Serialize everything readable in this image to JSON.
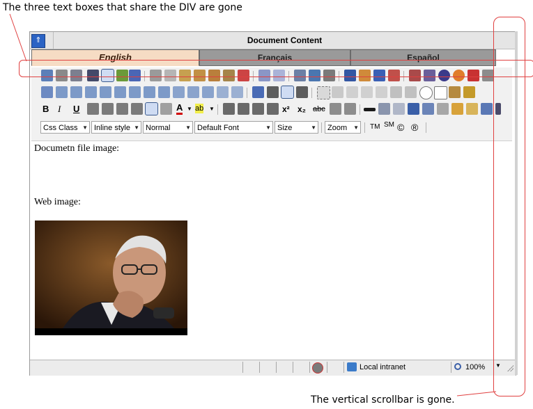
{
  "annotations": {
    "top_note": "The three text boxes that share the DIV are gone",
    "bottom_note": "The vertical scrollbar is gone."
  },
  "editor": {
    "title": "Document Content",
    "tabs": [
      {
        "label": "English",
        "active": true
      },
      {
        "label": "Français",
        "active": false
      },
      {
        "label": "Español",
        "active": false
      }
    ]
  },
  "toolbar": {
    "bold": "B",
    "italic": "I",
    "underline": "U",
    "font_color": "A",
    "highlight": "ab",
    "superscript": "x²",
    "subscript": "x₂",
    "strike": "abc",
    "trademark": "TM",
    "servicemark": "SM",
    "copyright": "©",
    "registered": "®",
    "combos": {
      "css_class": "Css Class",
      "inline_style": "Inline style",
      "paragraph": "Normal",
      "font": "Default Font",
      "size": "Size",
      "zoom": "Zoom"
    }
  },
  "content": {
    "line1": "Documetn file image:",
    "line2": "Web image:"
  },
  "status": {
    "zone": "Local intranet",
    "zoom": "100%"
  },
  "colors": {
    "accent": "#2b63c4",
    "annotation": "#e04040",
    "tab_active": "#f6dcc4",
    "tab_inactive": "#9a9a9a"
  }
}
